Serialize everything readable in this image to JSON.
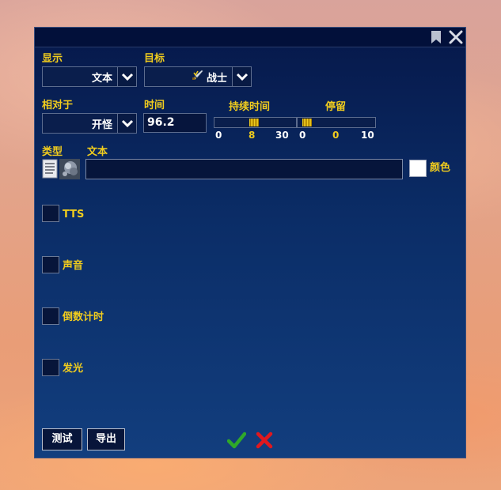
{
  "display": {
    "label": "显示",
    "value": "文本"
  },
  "target": {
    "label": "目标",
    "value": "战士",
    "icon": "sword-icon"
  },
  "relative": {
    "label": "相对于",
    "value": "开怪"
  },
  "time": {
    "label": "时间",
    "value": "96.2"
  },
  "duration": {
    "label": "持续时间",
    "min": "0",
    "value": "8",
    "max": "30",
    "fraction": 0.2667
  },
  "stay": {
    "label": "停留",
    "min": "0",
    "value": "0",
    "max": "10",
    "fraction": 0.0
  },
  "type": {
    "label": "类型"
  },
  "text": {
    "label": "文本",
    "value": ""
  },
  "color": {
    "label": "颜色",
    "swatch": "#ffffff"
  },
  "options": [
    {
      "label": "TTS",
      "checked": false
    },
    {
      "label": "声音",
      "checked": false
    },
    {
      "label": "倒数计时",
      "checked": false
    },
    {
      "label": "发光",
      "checked": false
    }
  ],
  "footer": {
    "test_label": "测试",
    "export_label": "导出",
    "confirm_icon": "checkmark-icon",
    "cancel_icon": "x-icon"
  },
  "colors": {
    "accent": "#f0cc1e",
    "panel": "#0b2d67",
    "confirm": "#2fa82a",
    "cancel": "#e0181e"
  }
}
